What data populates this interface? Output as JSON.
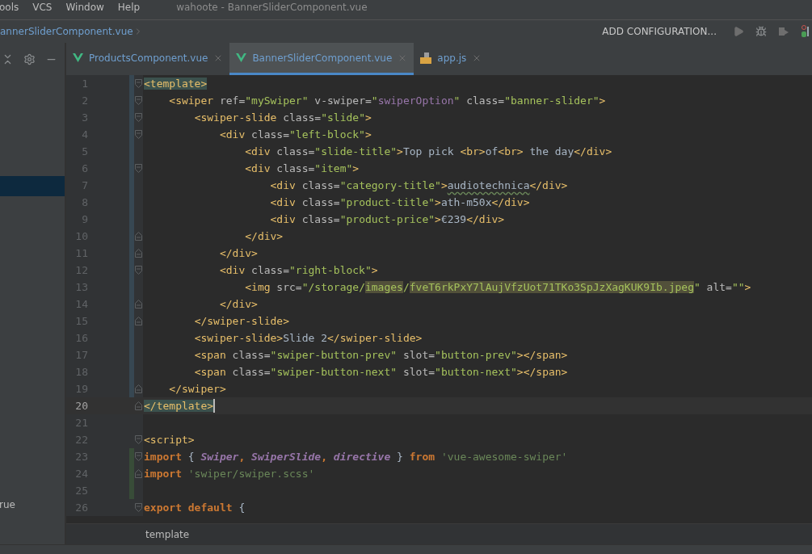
{
  "menu_bar": {
    "items": [
      "ools",
      "VCS",
      "Window",
      "Help"
    ],
    "title": "wahoote - BannerSliderComponent.vue"
  },
  "navigation_bar": {
    "breadcrumb": "annerSliderComponent.vue",
    "run_configuration": "ADD CONFIGURATION..."
  },
  "project_panel": {
    "selected_row": true,
    "partial_text": "rue"
  },
  "tabs": [
    {
      "label": "ProductsComponent.vue",
      "kind": "vue",
      "selected": false
    },
    {
      "label": "BannerSliderComponent.vue",
      "kind": "vue",
      "selected": true
    },
    {
      "label": "app.js",
      "kind": "js",
      "selected": false
    }
  ],
  "editor": {
    "lines": [
      {
        "number": "1",
        "fold_open": true,
        "fold_close": false,
        "modified": true,
        "added": false,
        "current": false,
        "tokens": [
          {
            "text": "<template>",
            "kind": "tag",
            "match": true
          }
        ]
      },
      {
        "number": "2",
        "fold_open": true,
        "fold_close": false,
        "modified": true,
        "added": false,
        "current": false,
        "tokens": [
          {
            "text": "    <swiper",
            "kind": "tag"
          },
          {
            "text": " ref=",
            "kind": "attr"
          },
          {
            "text": "\"mySwiper\"",
            "kind": "val"
          },
          {
            "text": " v-swiper=",
            "kind": "attr"
          },
          {
            "text": "\"",
            "kind": "val"
          },
          {
            "text": "swiperOption",
            "kind": "var"
          },
          {
            "text": "\"",
            "kind": "val"
          },
          {
            "text": " class=",
            "kind": "attr"
          },
          {
            "text": "\"banner-slider\"",
            "kind": "val"
          },
          {
            "text": ">",
            "kind": "tag"
          }
        ]
      },
      {
        "number": "3",
        "fold_open": true,
        "fold_close": false,
        "modified": true,
        "added": false,
        "current": false,
        "tokens": [
          {
            "text": "        <swiper-slide",
            "kind": "tag"
          },
          {
            "text": " class=",
            "kind": "attr"
          },
          {
            "text": "\"slide\"",
            "kind": "val"
          },
          {
            "text": ">",
            "kind": "tag"
          }
        ]
      },
      {
        "number": "4",
        "fold_open": true,
        "fold_close": false,
        "modified": true,
        "added": false,
        "current": false,
        "tokens": [
          {
            "text": "            <div",
            "kind": "tag"
          },
          {
            "text": " class=",
            "kind": "attr"
          },
          {
            "text": "\"left-block\"",
            "kind": "val"
          },
          {
            "text": ">",
            "kind": "tag"
          }
        ]
      },
      {
        "number": "5",
        "fold_open": false,
        "fold_close": false,
        "modified": true,
        "added": false,
        "current": false,
        "tokens": [
          {
            "text": "                <div",
            "kind": "tag"
          },
          {
            "text": " class=",
            "kind": "attr"
          },
          {
            "text": "\"slide-title\"",
            "kind": "val"
          },
          {
            "text": ">",
            "kind": "tag"
          },
          {
            "text": "Top pick ",
            "kind": "text"
          },
          {
            "text": "<br>",
            "kind": "tag"
          },
          {
            "text": "of",
            "kind": "text"
          },
          {
            "text": "<br>",
            "kind": "tag"
          },
          {
            "text": " the day",
            "kind": "text"
          },
          {
            "text": "</div>",
            "kind": "tag"
          }
        ]
      },
      {
        "number": "6",
        "fold_open": true,
        "fold_close": false,
        "modified": true,
        "added": false,
        "current": false,
        "tokens": [
          {
            "text": "                <div",
            "kind": "tag"
          },
          {
            "text": " class=",
            "kind": "attr"
          },
          {
            "text": "\"item\"",
            "kind": "val"
          },
          {
            "text": ">",
            "kind": "tag"
          }
        ]
      },
      {
        "number": "7",
        "fold_open": false,
        "fold_close": false,
        "modified": true,
        "added": false,
        "current": false,
        "tokens": [
          {
            "text": "                    <div",
            "kind": "tag"
          },
          {
            "text": " class=",
            "kind": "attr"
          },
          {
            "text": "\"category-title\"",
            "kind": "val"
          },
          {
            "text": ">",
            "kind": "tag"
          },
          {
            "text": "audiotechnica",
            "kind": "text",
            "typo": true
          },
          {
            "text": "</div>",
            "kind": "tag"
          }
        ]
      },
      {
        "number": "8",
        "fold_open": false,
        "fold_close": false,
        "modified": true,
        "added": false,
        "current": false,
        "tokens": [
          {
            "text": "                    <div",
            "kind": "tag"
          },
          {
            "text": " class=",
            "kind": "attr"
          },
          {
            "text": "\"product-title\"",
            "kind": "val"
          },
          {
            "text": ">",
            "kind": "tag"
          },
          {
            "text": "ath-m50x",
            "kind": "text"
          },
          {
            "text": "</div>",
            "kind": "tag"
          }
        ]
      },
      {
        "number": "9",
        "fold_open": false,
        "fold_close": false,
        "modified": true,
        "added": false,
        "current": false,
        "tokens": [
          {
            "text": "                    <div",
            "kind": "tag"
          },
          {
            "text": " class=",
            "kind": "attr"
          },
          {
            "text": "\"product-price\"",
            "kind": "val"
          },
          {
            "text": ">",
            "kind": "tag"
          },
          {
            "text": "€239",
            "kind": "text"
          },
          {
            "text": "</div>",
            "kind": "tag"
          }
        ]
      },
      {
        "number": "10",
        "fold_open": false,
        "fold_close": true,
        "modified": true,
        "added": false,
        "current": false,
        "tokens": [
          {
            "text": "                </div>",
            "kind": "tag"
          }
        ]
      },
      {
        "number": "11",
        "fold_open": false,
        "fold_close": true,
        "modified": true,
        "added": false,
        "current": false,
        "tokens": [
          {
            "text": "            </div>",
            "kind": "tag"
          }
        ]
      },
      {
        "number": "12",
        "fold_open": true,
        "fold_close": false,
        "modified": true,
        "added": false,
        "current": false,
        "tokens": [
          {
            "text": "            <div",
            "kind": "tag"
          },
          {
            "text": " class=",
            "kind": "attr"
          },
          {
            "text": "\"right-block\"",
            "kind": "val"
          },
          {
            "text": ">",
            "kind": "tag"
          }
        ]
      },
      {
        "number": "13",
        "fold_open": false,
        "fold_close": false,
        "modified": true,
        "added": false,
        "current": false,
        "tokens": [
          {
            "text": "                <img",
            "kind": "tag"
          },
          {
            "text": " src=",
            "kind": "attr"
          },
          {
            "text": "\"/storage/",
            "kind": "val"
          },
          {
            "text": "images",
            "kind": "val",
            "reference": true
          },
          {
            "text": "/",
            "kind": "val"
          },
          {
            "text": "fveT6rkPxY7lAujVfzUot71TKo3SpJzXagKUK9Ib.jpeg",
            "kind": "val",
            "reference": true
          },
          {
            "text": "\"",
            "kind": "val"
          },
          {
            "text": " alt=",
            "kind": "attr"
          },
          {
            "text": "\"\"",
            "kind": "val"
          },
          {
            "text": ">",
            "kind": "tag"
          }
        ]
      },
      {
        "number": "14",
        "fold_open": false,
        "fold_close": true,
        "modified": true,
        "added": false,
        "current": false,
        "tokens": [
          {
            "text": "            </div>",
            "kind": "tag"
          }
        ]
      },
      {
        "number": "15",
        "fold_open": false,
        "fold_close": true,
        "modified": true,
        "added": false,
        "current": false,
        "tokens": [
          {
            "text": "        </swiper-slide>",
            "kind": "tag"
          }
        ]
      },
      {
        "number": "16",
        "fold_open": false,
        "fold_close": false,
        "modified": true,
        "added": false,
        "current": false,
        "tokens": [
          {
            "text": "        <swiper-slide>",
            "kind": "tag"
          },
          {
            "text": "Slide 2",
            "kind": "text"
          },
          {
            "text": "</swiper-slide>",
            "kind": "tag"
          }
        ]
      },
      {
        "number": "17",
        "fold_open": false,
        "fold_close": false,
        "modified": true,
        "added": false,
        "current": false,
        "tokens": [
          {
            "text": "        <span",
            "kind": "tag"
          },
          {
            "text": " class=",
            "kind": "attr"
          },
          {
            "text": "\"swiper-button-prev\"",
            "kind": "val"
          },
          {
            "text": " slot=",
            "kind": "attr"
          },
          {
            "text": "\"button-prev\"",
            "kind": "val"
          },
          {
            "text": "></span>",
            "kind": "tag"
          }
        ]
      },
      {
        "number": "18",
        "fold_open": false,
        "fold_close": false,
        "modified": true,
        "added": false,
        "current": false,
        "tokens": [
          {
            "text": "        <span",
            "kind": "tag"
          },
          {
            "text": " class=",
            "kind": "attr"
          },
          {
            "text": "\"swiper-button-next\"",
            "kind": "val"
          },
          {
            "text": " slot=",
            "kind": "attr"
          },
          {
            "text": "\"button-next\"",
            "kind": "val"
          },
          {
            "text": "></span>",
            "kind": "tag"
          }
        ]
      },
      {
        "number": "19",
        "fold_open": false,
        "fold_close": true,
        "modified": true,
        "added": false,
        "current": false,
        "tokens": [
          {
            "text": "    </swiper>",
            "kind": "tag"
          }
        ]
      },
      {
        "number": "20",
        "fold_open": false,
        "fold_close": true,
        "modified": false,
        "added": false,
        "current": true,
        "tokens": [
          {
            "text": "</template>",
            "kind": "tag",
            "match": true
          }
        ]
      },
      {
        "number": "21",
        "fold_open": false,
        "fold_close": false,
        "modified": false,
        "added": false,
        "current": false
      },
      {
        "number": "22",
        "fold_open": true,
        "fold_close": false,
        "modified": false,
        "added": false,
        "current": false,
        "tokens": [
          {
            "text": "<script>",
            "kind": "tag"
          }
        ]
      },
      {
        "number": "23",
        "fold_open": true,
        "fold_close": false,
        "modified": false,
        "added": true,
        "current": false,
        "tokens": [
          {
            "text": "import",
            "kind": "kw"
          },
          {
            "text": " { ",
            "kind": "text"
          },
          {
            "text": "Swiper",
            "kind": "ident"
          },
          {
            "text": ", ",
            "kind": "kw"
          },
          {
            "text": "SwiperSlide",
            "kind": "ident"
          },
          {
            "text": ", ",
            "kind": "kw"
          },
          {
            "text": "directive",
            "kind": "ident"
          },
          {
            "text": " } ",
            "kind": "text"
          },
          {
            "text": "from",
            "kind": "kw"
          },
          {
            "text": " 'vue-awesome-swiper'",
            "kind": "jsstr"
          }
        ]
      },
      {
        "number": "24",
        "fold_open": false,
        "fold_close": true,
        "modified": false,
        "added": true,
        "current": false,
        "tokens": [
          {
            "text": "import",
            "kind": "kw"
          },
          {
            "text": " 'swiper/swiper.scss'",
            "kind": "jsstr"
          }
        ]
      },
      {
        "number": "25",
        "fold_open": false,
        "fold_close": false,
        "modified": false,
        "added": true,
        "current": false
      },
      {
        "number": "26",
        "fold_open": true,
        "fold_close": false,
        "modified": false,
        "added": false,
        "current": false,
        "tokens": [
          {
            "text": "export default",
            "kind": "kw"
          },
          {
            "text": " {",
            "kind": "text"
          }
        ]
      }
    ]
  },
  "breadcrumb_bar": {
    "path": "template"
  }
}
